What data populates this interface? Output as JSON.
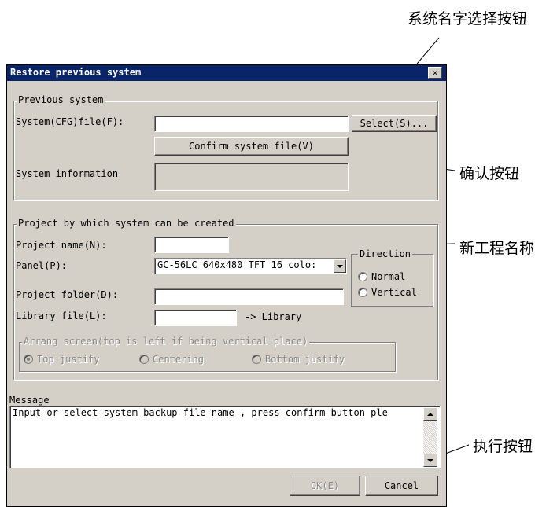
{
  "callouts": {
    "select_button": "系统名字选择按钮",
    "confirm_button": "确认按钮",
    "project_name": "新工程名称",
    "execute_button": "执行按钮"
  },
  "dialog": {
    "title": "Restore previous system",
    "close_glyph": "✕",
    "previous_system": {
      "legend": "Previous system",
      "cfg_label": "System(CFG)file(F):",
      "cfg_value": "",
      "select_button": "Select(S)...",
      "confirm_button": "Confirm system file(V)",
      "info_label": "System information",
      "info_value": ""
    },
    "project": {
      "legend": "Project by which system can be created",
      "name_label": "Project name(N):",
      "name_value": "",
      "panel_label": "Panel(P):",
      "panel_value": "GC-56LC 640x480 TFT 16 colo:",
      "folder_label": "Project folder(D):",
      "folder_value": "",
      "library_label": "Library file(L):",
      "library_value": "",
      "library_suffix": "-> Library",
      "direction": {
        "legend": "Direction",
        "options": [
          "Normal",
          "Vertical"
        ]
      },
      "arrange": {
        "legend": "Arrang screen(top is left if being vertical place)",
        "options": [
          "Top justify",
          "Centering",
          "Bottom justify"
        ],
        "selected": "Top justify"
      }
    },
    "message": {
      "label": "Message",
      "text": "Input or select system backup file name , press confirm button ple"
    },
    "ok_button": "OK(E)",
    "cancel_button": "Cancel"
  }
}
